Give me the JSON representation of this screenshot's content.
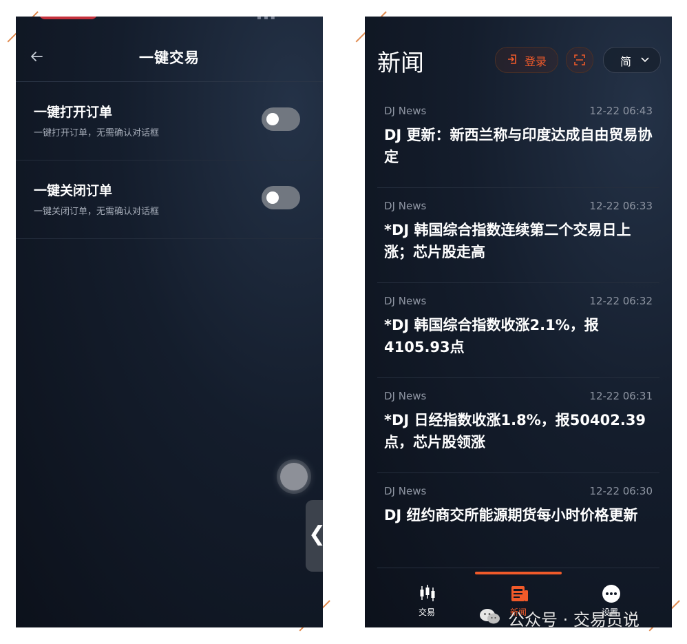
{
  "left": {
    "title": "一键交易",
    "settings": [
      {
        "title": "一键打开订单",
        "description": "一键打开订单，无需确认对话框",
        "enabled": false
      },
      {
        "title": "一键关闭订单",
        "description": "一键关闭订单，无需确认对话框",
        "enabled": false
      }
    ],
    "side_tab_glyph": "❮"
  },
  "right": {
    "title": "新闻",
    "login_label": "登录",
    "language_label": "简",
    "news": [
      {
        "source": "DJ News",
        "time": "12-22 06:43",
        "headline": "DJ 更新：新西兰称与印度达成自由贸易协定"
      },
      {
        "source": "DJ News",
        "time": "12-22 06:33",
        "headline": "*DJ 韩国综合指数连续第二个交易日上涨；芯片股走高"
      },
      {
        "source": "DJ News",
        "time": "12-22 06:32",
        "headline": "*DJ 韩国综合指数收涨2.1%，报4105.93点"
      },
      {
        "source": "DJ News",
        "time": "12-22 06:31",
        "headline": "*DJ 日经指数收涨1.8%，报50402.39点，芯片股领涨"
      },
      {
        "source": "DJ News",
        "time": "12-22 06:30",
        "headline": "DJ 纽约商交所能源期货每小时价格更新"
      }
    ],
    "tabs": [
      {
        "label": "交易",
        "icon": "candlestick-icon",
        "active": false
      },
      {
        "label": "新闻",
        "icon": "newspaper-icon",
        "active": true
      },
      {
        "label": "设置",
        "icon": "more-dots-icon",
        "active": false
      }
    ],
    "accent_color": "#f05a2a"
  },
  "watermark": {
    "text": "公众号 · 交易员说"
  }
}
